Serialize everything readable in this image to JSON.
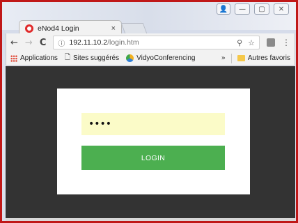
{
  "window": {
    "controls": {
      "minimize": "—",
      "maximize": "▢",
      "close": "✕"
    }
  },
  "tab": {
    "title": "eNod4 Login",
    "close": "×"
  },
  "toolbar": {
    "back": "←",
    "forward": "→",
    "reload": "C",
    "info": "ⓘ",
    "url_host": "192.11.10.2",
    "url_path": "/login.htm",
    "pin_icon": "pin-icon",
    "star": "☆",
    "menu": "⋮"
  },
  "bookmarks": {
    "apps": "Applications",
    "suggested": "Sites suggérés",
    "vidyo": "VidyoConferencing",
    "more": "»",
    "other": "Autres favoris"
  },
  "login": {
    "password_value": "••••",
    "button_label": "LOGIN",
    "button_color": "#4caf50",
    "field_color": "#fbfbc8"
  },
  "colors": {
    "frame_border": "#c01818",
    "viewport_bg": "#333333"
  }
}
